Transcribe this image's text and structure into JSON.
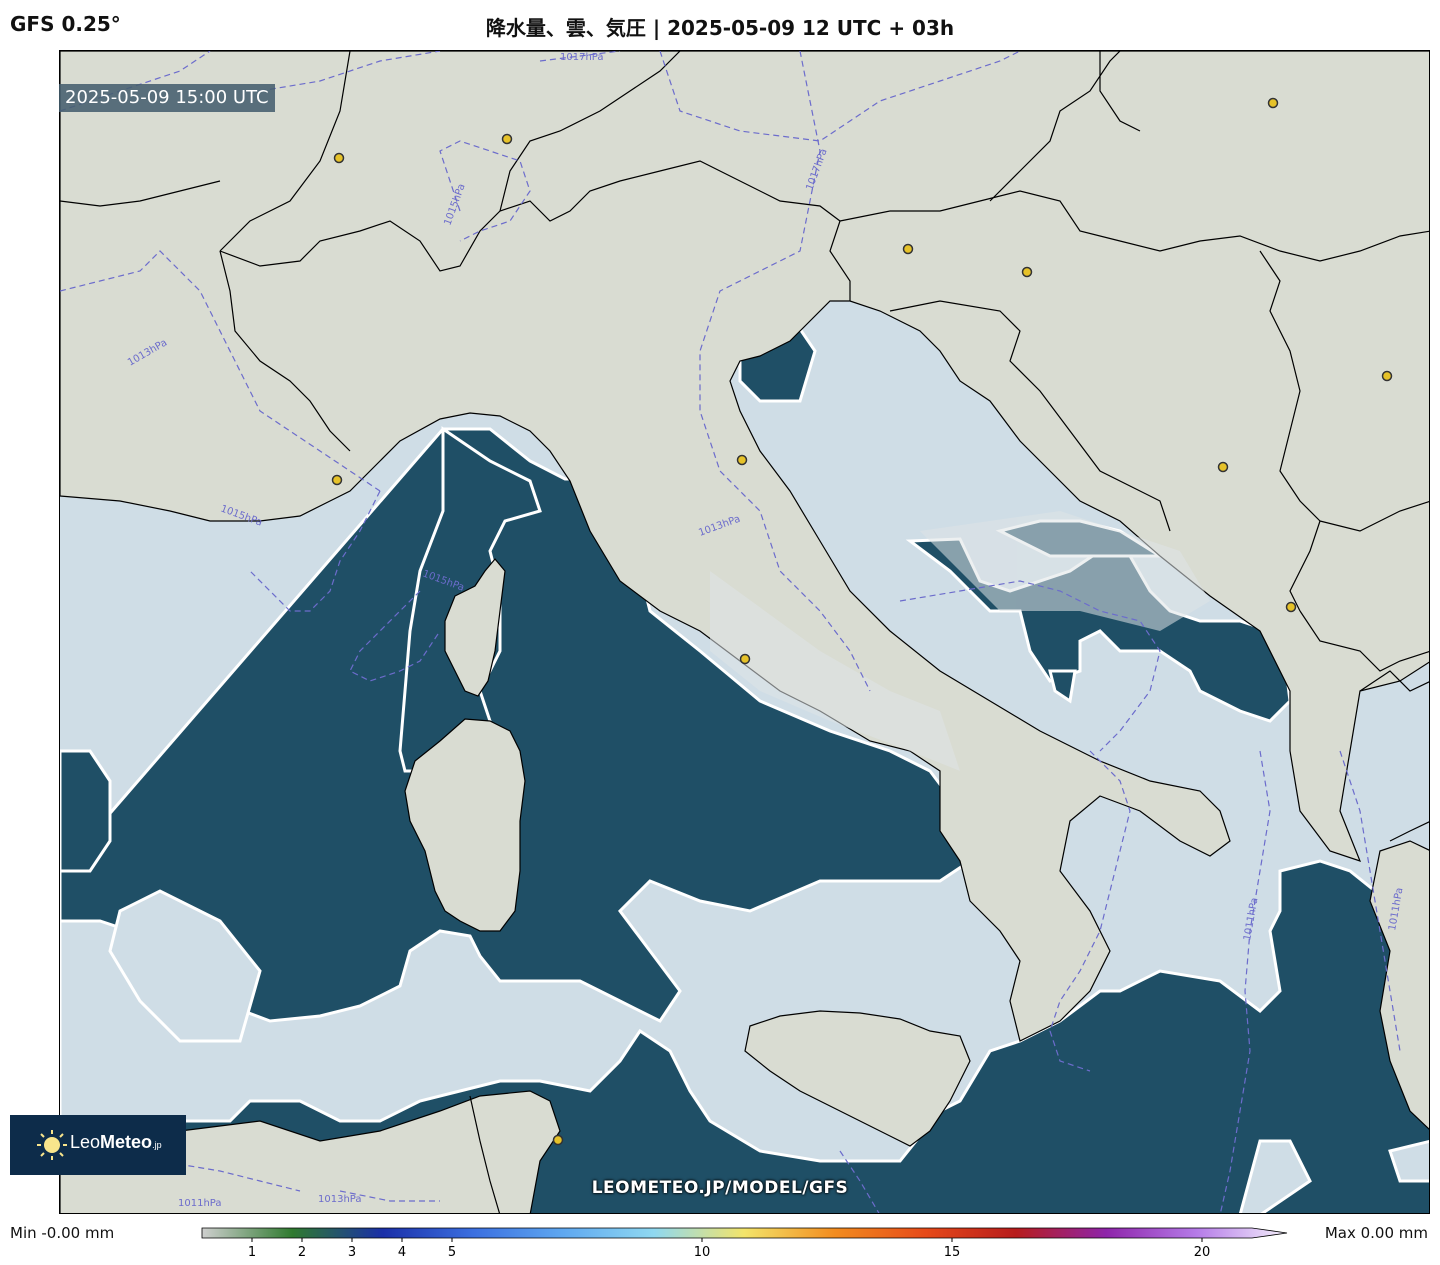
{
  "header": {
    "model": "GFS 0.25°",
    "title": "降水量、雲、気圧 | 2025-05-09 12 UTC + 03h"
  },
  "map": {
    "valid_time": "2025-05-09 15:00 UTC",
    "isobar_labels": [
      "1017hPa",
      "1015hPa",
      "1017hPa",
      "1013hPa",
      "1015hPa",
      "1013hPa",
      "1015hPa",
      "1011hPa",
      "1011hPa",
      "1013hPa",
      "1011hPa"
    ],
    "colors": {
      "land": "#d9dcd2",
      "cloud": "#cfdde6",
      "cloud_edge": "#ffffff",
      "sea_clear": "#1f4f66",
      "isobar": "#6c6ccc",
      "border": "#000000",
      "city_marker": "#e6c229"
    },
    "watermark": "LEOMETEO.JP/MODEL/GFS",
    "logo": {
      "text_light": "Leo",
      "text_bold": "Meteo",
      "text_suffix": ".jp",
      "icon": "sun-icon"
    }
  },
  "colorbar": {
    "min_label": "Min -0.00 mm",
    "max_label": "Max 0.00 mm",
    "ticks": [
      "1",
      "2",
      "3",
      "4",
      "5",
      "10",
      "15",
      "20"
    ],
    "tick_values": [
      1,
      2,
      3,
      4,
      5,
      10,
      15,
      20
    ],
    "range": [
      0,
      21
    ],
    "stops": [
      "#cfcfcf",
      "#2f7a2f",
      "#1a2fa8",
      "#3b6fe0",
      "#5fa8f0",
      "#8fd8f0",
      "#f3e46a",
      "#f28c1f",
      "#e64a19",
      "#b71c1c",
      "#8e24aa",
      "#b57be8",
      "#f4f0fb"
    ]
  }
}
